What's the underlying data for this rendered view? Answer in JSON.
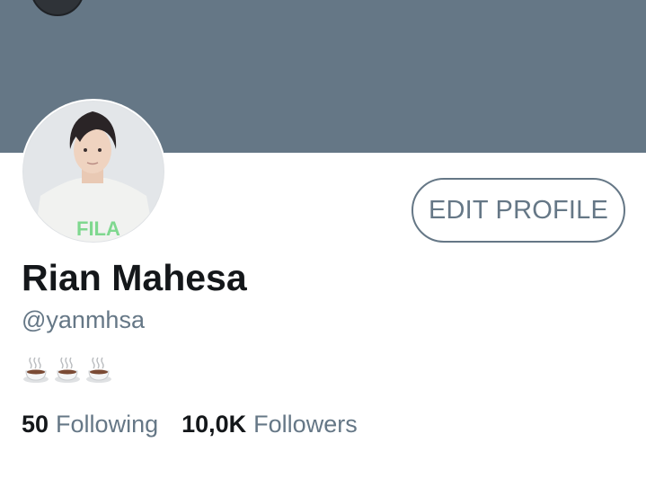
{
  "colors": {
    "banner": "#657786",
    "text_primary": "#14171a",
    "text_secondary": "#657786",
    "button_border": "#657786"
  },
  "header": {
    "back_icon": "dark-circle-icon"
  },
  "profile": {
    "avatar_icon": "profile-photo",
    "edit_button_label": "EDIT PROFILE",
    "display_name": "Rian Mahesa",
    "handle": "@yanmhsa",
    "bio_icons": [
      "hot-beverage-icon",
      "hot-beverage-icon",
      "hot-beverage-icon"
    ]
  },
  "stats": {
    "following_count": "50",
    "following_label": "Following",
    "followers_count": "10,0K",
    "followers_label": "Followers"
  }
}
